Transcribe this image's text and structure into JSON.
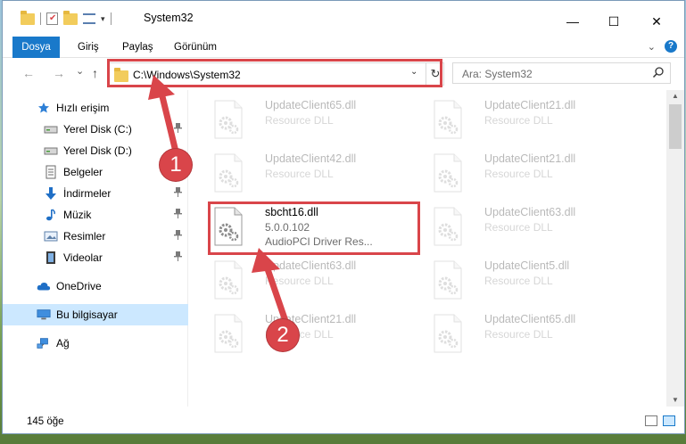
{
  "window": {
    "title": "System32",
    "controls": {
      "minimize": "—",
      "maximize": "☐",
      "close": "✕"
    }
  },
  "ribbon": {
    "tabs": [
      {
        "label": "Dosya",
        "active": true
      },
      {
        "label": "Giriş"
      },
      {
        "label": "Paylaş"
      },
      {
        "label": "Görünüm"
      }
    ],
    "expand_icon": "chevron-down-icon",
    "help_icon": "help-icon",
    "help_glyph": "?"
  },
  "nav": {
    "back_glyph": "←",
    "forward_glyph": "→",
    "recent_glyph": "⌄",
    "up_glyph": "↑",
    "address": "C:\\Windows\\System32",
    "dropdown_glyph": "⌄",
    "refresh_glyph": "↻",
    "search_placeholder": "Ara: System32",
    "search_glyph": "⚲"
  },
  "sidebar": {
    "items": [
      {
        "label": "Hızlı erişim",
        "icon": "star-icon"
      },
      {
        "label": "Yerel Disk (C:)",
        "icon": "drive-icon",
        "pinned": true
      },
      {
        "label": "Yerel Disk (D:)",
        "icon": "drive-icon"
      },
      {
        "label": "Belgeler",
        "icon": "documents-icon"
      },
      {
        "label": "İndirmeler",
        "icon": "download-icon",
        "pinned": true
      },
      {
        "label": "Müzik",
        "icon": "music-icon",
        "pinned": true
      },
      {
        "label": "Resimler",
        "icon": "pictures-icon",
        "pinned": true
      },
      {
        "label": "Videolar",
        "icon": "videos-icon",
        "pinned": true
      },
      {
        "label": "OneDrive",
        "icon": "cloud-icon"
      },
      {
        "label": "Bu bilgisayar",
        "icon": "computer-icon",
        "selected": true
      },
      {
        "label": "Ağ",
        "icon": "network-icon"
      }
    ],
    "pin_glyph": "📌"
  },
  "files": [
    {
      "name": "UpdateClient65.dll",
      "lines": [
        "Resource DLL"
      ],
      "faded": true
    },
    {
      "name": "UpdateClient21.dll",
      "lines": [
        "Resource DLL"
      ],
      "faded": true
    },
    {
      "name": "UpdateClient42.dll",
      "lines": [
        "Resource DLL"
      ],
      "faded": true
    },
    {
      "name": "UpdateClient21.dll",
      "lines": [
        "Resource DLL"
      ],
      "faded": true
    },
    {
      "name": "sbcht16.dll",
      "lines": [
        "5.0.0.102",
        "AudioPCI Driver Res..."
      ],
      "faded": false,
      "highlighted": true
    },
    {
      "name": "UpdateClient63.dll",
      "lines": [
        "Resource DLL"
      ],
      "faded": true
    },
    {
      "name": "UpdateClient63.dll",
      "lines": [
        "Resource DLL"
      ],
      "faded": true
    },
    {
      "name": "UpdateClient5.dll",
      "lines": [
        "Resource DLL"
      ],
      "faded": true
    },
    {
      "name": "UpdateClient21.dll",
      "lines": [
        "Resource DLL"
      ],
      "faded": true
    },
    {
      "name": "UpdateClient65.dll",
      "lines": [
        "Resource DLL"
      ],
      "faded": true
    }
  ],
  "status": {
    "item_count": "145 öğe"
  },
  "annotations": [
    {
      "number": "1",
      "color": "#d9454a"
    },
    {
      "number": "2",
      "color": "#d9454a"
    }
  ],
  "colors": {
    "accent": "#1979ca",
    "highlight_red": "#d9454a",
    "selected_bg": "#cce8ff"
  }
}
